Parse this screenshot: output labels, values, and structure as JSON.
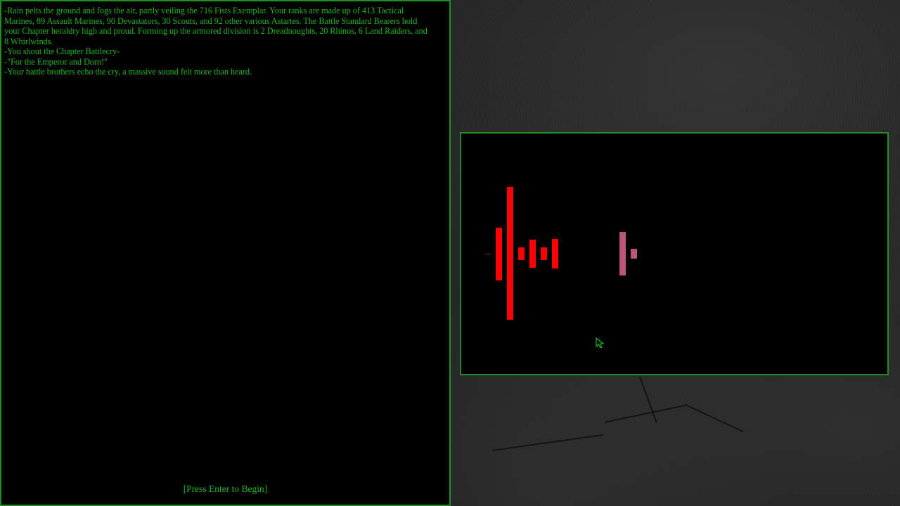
{
  "log": {
    "lines": [
      "-Rain pelts the ground and fogs the air, partly veiling the 716 Fists Exemplar.  Your ranks are made up of 413 Tactical Marines, 89 Assault Marines, 90 Devastators, 30 Scouts, and 92 other various Astartes.  The Battle Standard Bearers hold your Chapter heraldry high and proud.  Forming up the armored division is 2 Dreadnoughts, 20 Rhinos, 6 Land Raiders, and 8 Whirlwinds.",
      "-You shout the Chapter Battlecry-",
      "-\"For the Emperor and Dorn!\"",
      "-Your battle brothers echo the cry, a massive sound felt more than heard."
    ],
    "prompt": "[Press Enter to Begin]"
  },
  "colors": {
    "text": "#1fb51f",
    "border": "#1f8f1f",
    "player_units": "#ff0000",
    "enemy_units": "#b8577a"
  },
  "battlefield": {
    "player_units": "red-columns",
    "enemy_units": "pink-columns"
  }
}
